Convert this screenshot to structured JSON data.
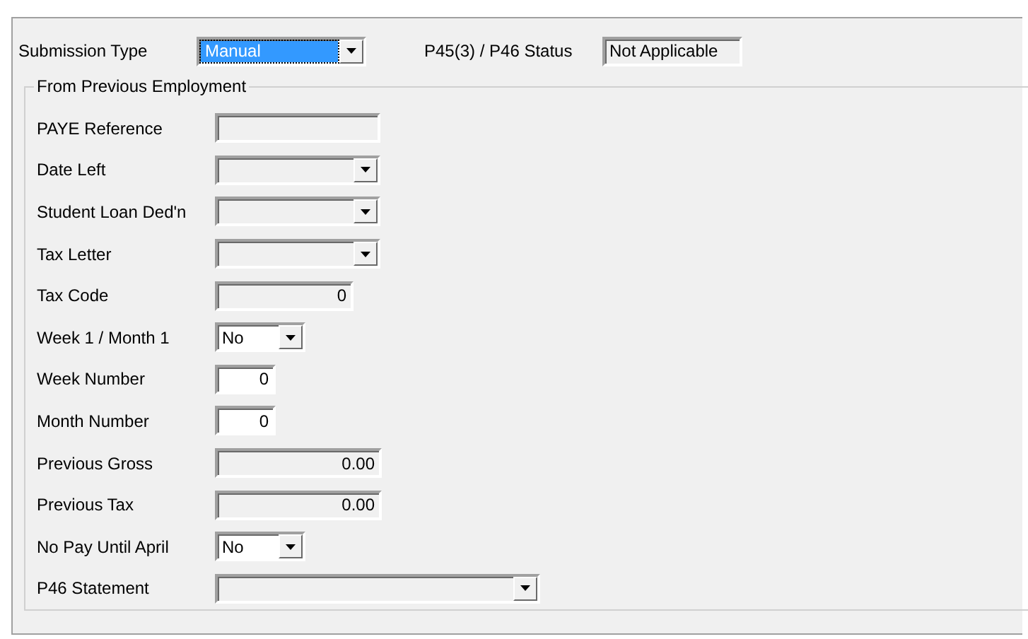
{
  "submission_type": {
    "label": "Submission Type",
    "value": "Manual",
    "focused": true
  },
  "status": {
    "label": "P45(3) / P46 Status",
    "value": "Not Applicable"
  },
  "group": {
    "title": "From Previous Employment",
    "fields": [
      {
        "label": "PAYE Reference",
        "kind": "text",
        "disabled": true
      },
      {
        "label": "Date Left",
        "kind": "dropdown",
        "disabled": true
      },
      {
        "label": "Student Loan Ded'n",
        "kind": "dropdown",
        "disabled": true
      },
      {
        "label": "Tax Letter",
        "kind": "dropdown",
        "disabled": true
      },
      {
        "label": "Tax Code",
        "kind": "text",
        "disabled": true,
        "value": "0"
      },
      {
        "label": "Week 1 / Month 1",
        "kind": "dropdown",
        "disabled": false,
        "value": "No"
      },
      {
        "label": "Week Number",
        "kind": "text",
        "disabled": false,
        "value": "0"
      },
      {
        "label": "Month Number",
        "kind": "text",
        "disabled": false,
        "value": "0"
      },
      {
        "label": "Previous Gross",
        "kind": "text",
        "disabled": true,
        "value": "0.00"
      },
      {
        "label": "Previous Tax",
        "kind": "text",
        "disabled": true,
        "value": "0.00"
      },
      {
        "label": "No Pay Until April",
        "kind": "dropdown",
        "disabled": false,
        "value": "No"
      },
      {
        "label": "P46 Statement",
        "kind": "dropdown",
        "disabled": true
      }
    ]
  }
}
